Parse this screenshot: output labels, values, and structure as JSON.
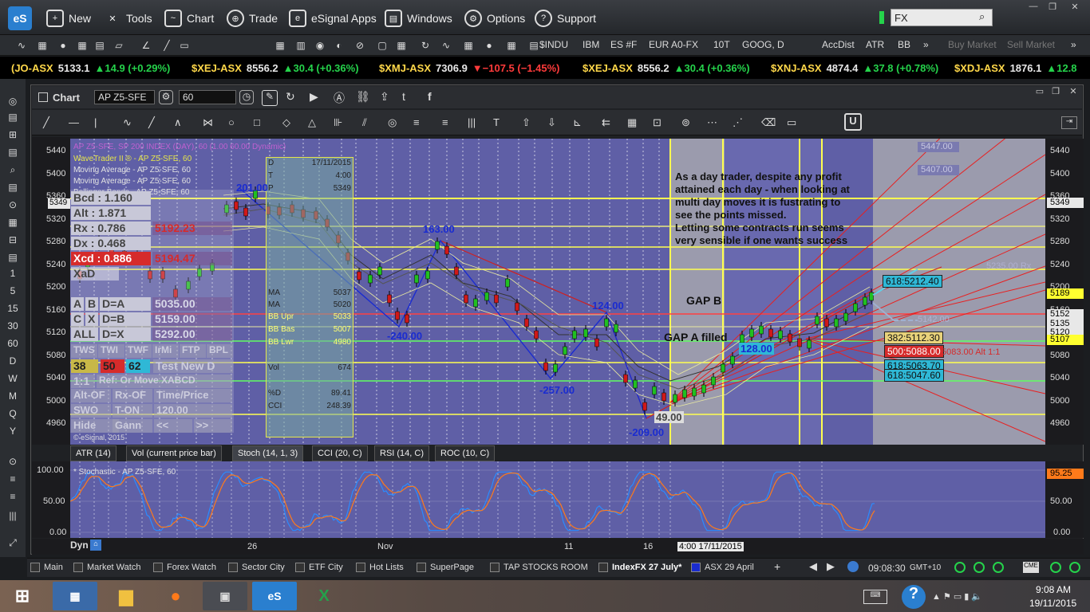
{
  "app": {
    "logo": "eS"
  },
  "menu": [
    {
      "label": "New",
      "icon": "new-icon"
    },
    {
      "label": "Tools",
      "icon": "tools-icon"
    },
    {
      "label": "Chart",
      "icon": "chart-icon"
    },
    {
      "label": "Trade",
      "icon": "globe-icon"
    },
    {
      "label": "eSignal Apps",
      "icon": "apps-icon"
    },
    {
      "label": "Windows",
      "icon": "windows-icon"
    },
    {
      "label": "Options",
      "icon": "gear-icon"
    },
    {
      "label": "Support",
      "icon": "help-icon"
    }
  ],
  "search": {
    "value": "FX"
  },
  "toolbar2": {
    "symbols": [
      "$INDU",
      "IBM",
      "ES #F",
      "EUR A0-FX",
      "10T",
      "GOOG, D",
      "AccDist",
      "ATR",
      "BB"
    ],
    "more": "»",
    "buy": "Buy Market",
    "sell": "Sell Market"
  },
  "ticker": [
    {
      "sym": "(JO-ASX",
      "price": "5133.1",
      "chg": "14.9 (+0.29%)",
      "dir": "up"
    },
    {
      "sym": "$XEJ-ASX",
      "price": "8556.2",
      "chg": "30.4 (+0.36%)",
      "dir": "up"
    },
    {
      "sym": "$XMJ-ASX",
      "price": "7306.9",
      "chg": "−107.5 (−1.45%)",
      "dir": "down"
    },
    {
      "sym": "$XEJ-ASX",
      "price": "8556.2",
      "chg": "30.4 (+0.36%)",
      "dir": "up"
    },
    {
      "sym": "$XNJ-ASX",
      "price": "4874.4",
      "chg": "37.8 (+0.78%)",
      "dir": "up"
    },
    {
      "sym": "$XDJ-ASX",
      "price": "1876.1",
      "chg": "12.8",
      "dir": "up"
    }
  ],
  "leftdock": [
    "1",
    "5",
    "15",
    "30",
    "60",
    "D",
    "W",
    "M",
    "Q",
    "Y"
  ],
  "chart": {
    "title": "Chart",
    "symbol": "AP Z5-SFE",
    "interval": "60",
    "study_title": "AP Z5-SFE, SP 200 INDEX (DAY), 60 (1.00 60.00 Dynamic)",
    "studies": [
      "WaveTrader II ® - AP Z5-SFE, 60",
      "Moving Average - AP Z5-SFE, 60",
      "Moving Average - AP Z5-SFE, 60",
      "Bollinger Bands - AP Z5-SFE, 60"
    ],
    "yticks": [
      "5440",
      "5400",
      "5360",
      "5320",
      "5280",
      "5240",
      "5200",
      "5160",
      "5120",
      "5080",
      "5040",
      "5000",
      "4960"
    ],
    "price_tags": [
      {
        "v": "5447.00",
        "c": "#8a8aa8"
      },
      {
        "v": "5407.00",
        "c": "#8a8aa8"
      },
      {
        "v": "5349",
        "c": "#e8e8e8"
      },
      {
        "v": "5189",
        "c": "#ffff30"
      },
      {
        "v": "5152",
        "c": "#e8e8e8"
      },
      {
        "v": "5135",
        "c": "#e8e8e8"
      },
      {
        "v": "5120",
        "c": "#e8e8e8"
      },
      {
        "v": "5107",
        "c": "#ffff30"
      }
    ],
    "annotation": "As a day trader, despite any profit attained each day - when looking at multi day moves it is fustrating to see the points missed.\nLetting some contracts run seems very sensible if one wants success",
    "gap_b": "GAP B",
    "gap_a": "GAP A filled",
    "wave_labels": [
      {
        "t": "201.00",
        "c": "#1a2cd0"
      },
      {
        "t": "163.00",
        "c": "#1a2cd0"
      },
      {
        "t": "-240.00",
        "c": "#1a2cd0"
      },
      {
        "t": "124.00",
        "c": "#1a2cd0"
      },
      {
        "t": "-257.00",
        "c": "#1a2cd0"
      },
      {
        "t": "49.00",
        "c": "#1a2cd0"
      },
      {
        "t": "-209.00",
        "c": "#1a2cd0"
      },
      {
        "t": "128.00",
        "c": "#1a2cd0"
      }
    ],
    "fib_tags": [
      {
        "t": "618:5212.40",
        "bg": "#2fb8d6"
      },
      {
        "t": "382:5112.30",
        "bg": "#e8d27a"
      },
      {
        "t": "500:5088.00",
        "bg": "#d62b2b"
      },
      {
        "t": "618:5063.70",
        "bg": "#2fb8d6"
      },
      {
        "t": "618:5047.60",
        "bg": "#2fb8d6"
      }
    ],
    "right_tags": [
      {
        "t": "5235.00 Rx"
      },
      {
        "t": "5142.00"
      },
      {
        "t": "5083.00 Alt 1:1"
      }
    ],
    "copyright": "© eSignal, 2015",
    "xaxis": [
      {
        "t": "26"
      },
      {
        "t": "Nov"
      },
      {
        "t": "11"
      },
      {
        "t": "16"
      },
      {
        "t": "4:00 17/11/2015"
      }
    ]
  },
  "wavepanel": {
    "rows": [
      [
        "Bcd",
        "1.160"
      ],
      [
        "Alt",
        "1.871"
      ],
      [
        "Rx",
        "0.786"
      ],
      [
        "Dx",
        "0.468"
      ],
      [
        "Xcd",
        "0.886"
      ]
    ],
    "right": [
      "5192.23",
      "5194.47"
    ],
    "xad": "XaD",
    "grid": [
      [
        "A",
        "B",
        "D=A",
        "5035.00"
      ],
      [
        "C",
        "X",
        "D=B",
        "5159.00"
      ],
      [
        "ALL",
        "D=X",
        "5292.00"
      ]
    ],
    "btns": [
      "TWS",
      "TWI",
      "TWF",
      "IrMi",
      "FTP",
      "BPL"
    ],
    "nums": [
      "38",
      "50",
      "62",
      "Test New D"
    ],
    "misc": [
      "1:1",
      "Ref: Or Move XABCD",
      "Alt-OF",
      "Rx-OF",
      "Time/Price",
      "SWO",
      "T-ON",
      "120.00",
      "Hide",
      "Gann",
      "<<",
      ">>"
    ]
  },
  "datawin": {
    "rows": [
      [
        "D",
        "17/11/2015"
      ],
      [
        "T",
        "4:00"
      ],
      [
        "P",
        "5349"
      ],
      [
        "BB Upr",
        "5033"
      ],
      [
        "BB Bas",
        "5007"
      ],
      [
        "BB Lwr",
        "4980"
      ],
      [
        "MA",
        "5037"
      ],
      [
        "MA",
        "5020"
      ],
      [
        "Vol",
        "674"
      ],
      [
        "%D",
        "89.41"
      ],
      [
        "CCI",
        "248.39"
      ]
    ]
  },
  "lower": {
    "tabs": [
      "ATR (14)",
      "Vol (current price bar)",
      "Stoch (14, 1, 3)",
      "CCI (20, C)",
      "RSI (14, C)",
      "ROC (10, C)"
    ],
    "stoch_title": "* Stochastic - AP Z5-SFE, 60",
    "yticks": [
      "100.00",
      "50.00",
      "0.00"
    ],
    "right_ticks": [
      "50.00",
      "0.00"
    ],
    "tag": "95.25",
    "dyn": "Dyn"
  },
  "pages": [
    "Main",
    "Market Watch",
    "Forex Watch",
    "Sector City",
    "ETF City",
    "Hot Lists",
    "SuperPage",
    "TAP STOCKS ROOM",
    "IndexFX 27 July*",
    "ASX 29 April"
  ],
  "clock": {
    "time": "09:08:30",
    "tz": "GMT+10"
  },
  "taskbar": {
    "time": "9:08 AM",
    "date": "19/11/2015",
    "apps": [
      "windows-start",
      "control-panel",
      "file-explorer",
      "firefox",
      "remote-desktop",
      "esignal",
      "excel"
    ]
  }
}
